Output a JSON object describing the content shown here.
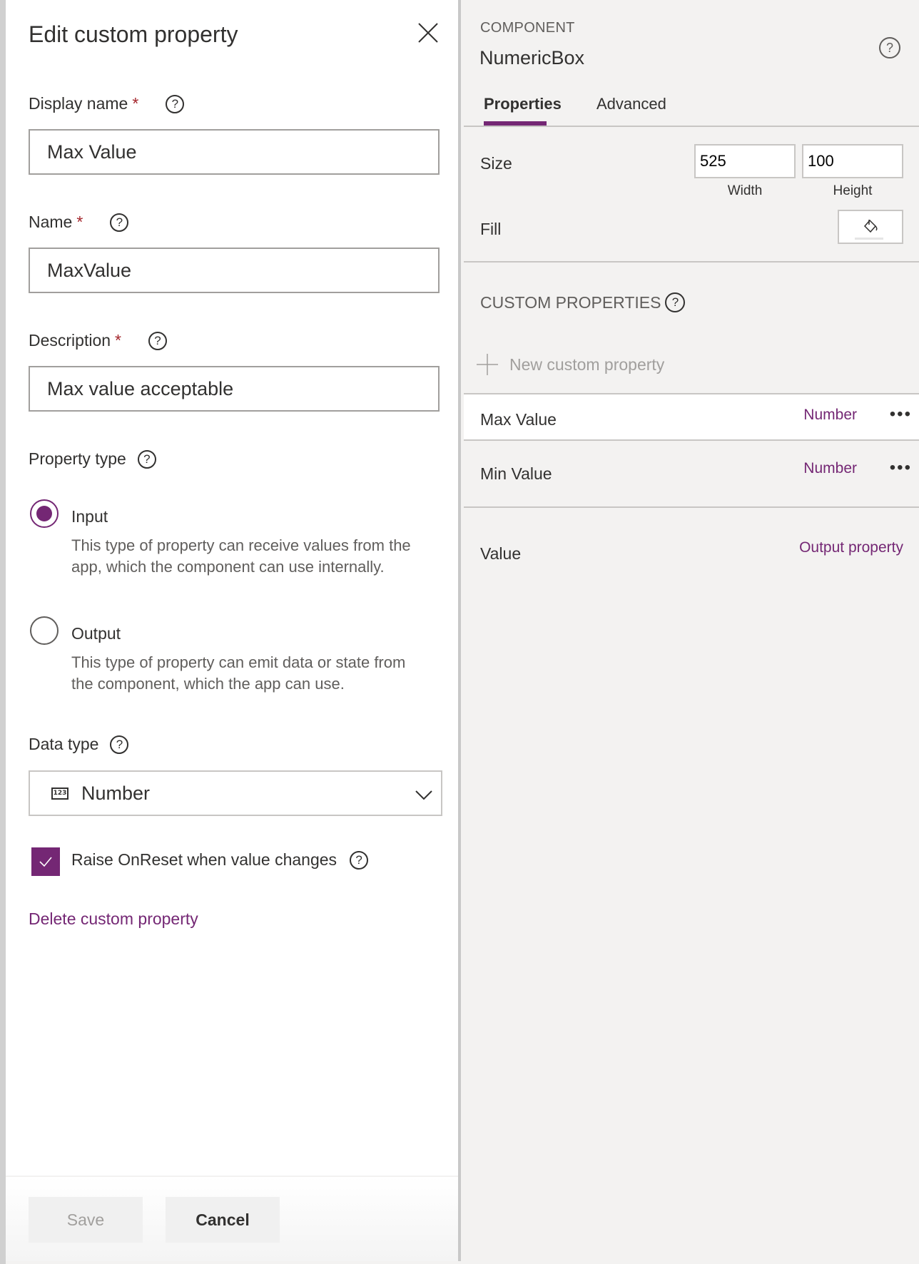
{
  "dialog": {
    "title": "Edit custom property",
    "close_icon": "close-icon",
    "fields": {
      "display_name": {
        "label": "Display name",
        "required_mark": "*",
        "help": "?",
        "value": "Max Value"
      },
      "name": {
        "label": "Name",
        "required_mark": "*",
        "help": "?",
        "value": "MaxValue"
      },
      "description": {
        "label": "Description",
        "required_mark": "*",
        "help": "?",
        "value": "Max value acceptable"
      }
    },
    "property_type": {
      "label": "Property type",
      "help": "?",
      "options": [
        {
          "label": "Input",
          "description": "This type of property can receive values from the app, which the component can use internally.",
          "selected": true
        },
        {
          "label": "Output",
          "description": "This type of property can emit data or state from the component, which the app can use.",
          "selected": false
        }
      ]
    },
    "data_type": {
      "label": "Data type",
      "help": "?",
      "icon_text": "123",
      "value": "Number"
    },
    "raise_onreset": {
      "label": "Raise OnReset when value changes",
      "help": "?",
      "checked": true
    },
    "delete_link": "Delete custom property",
    "buttons": {
      "save": "Save",
      "cancel": "Cancel"
    }
  },
  "panel": {
    "caption": "COMPONENT",
    "component_name": "NumericBox",
    "help": "?",
    "tabs": [
      {
        "label": "Properties",
        "active": true
      },
      {
        "label": "Advanced",
        "active": false
      }
    ],
    "size": {
      "label": "Size",
      "width": "525",
      "height": "100",
      "width_label": "Width",
      "height_label": "Height"
    },
    "fill": {
      "label": "Fill"
    },
    "custom_properties": {
      "header": "CUSTOM PROPERTIES",
      "help": "?",
      "new_label": "New custom property",
      "items": [
        {
          "name": "Max Value",
          "type": "Number",
          "more": "•••",
          "selected": true
        },
        {
          "name": "Min Value",
          "type": "Number",
          "more": "•••",
          "selected": false
        }
      ],
      "output": {
        "name": "Value",
        "type": "Output property"
      }
    }
  },
  "colors": {
    "accent": "#742774",
    "required": "#a4262c",
    "panel_bg": "#f3f2f1"
  }
}
